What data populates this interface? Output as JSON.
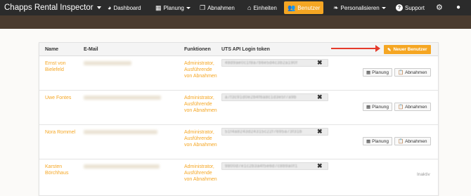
{
  "navbar": {
    "brand": "Chapps Rental Inspector",
    "items": [
      {
        "label": "Dashboard",
        "icon": "palette-icon"
      },
      {
        "label": "Planung",
        "icon": "calendar-icon"
      },
      {
        "label": "Abnahmen",
        "icon": "document-icon"
      },
      {
        "label": "Einheiten",
        "icon": "home-icon"
      },
      {
        "label": "Benutzer",
        "icon": "users-icon",
        "active": true
      },
      {
        "label": "Personalisieren",
        "icon": "leaf-icon"
      },
      {
        "label": "Support",
        "icon": "question-icon"
      }
    ]
  },
  "table": {
    "columns": [
      "Name",
      "E-Mail",
      "Funktionen",
      "UTS API Login token"
    ],
    "new_user_button": "Neuer Benutzer",
    "rows": [
      {
        "name": "Ernst von Bielefeld",
        "funktionen": "Administrator, Ausführende von Abnahmen",
        "token": "48d9ae0c1f8a7b6e5d4c3b2a190f",
        "buttons": [
          "Planung",
          "Abnahmen"
        ],
        "status": ""
      },
      {
        "name": "Uwe Fontes",
        "funktionen": "Administrator, Ausführende von Abnahmen",
        "token": "a7f3c91d0e2b4f6a8c1d3e5f7a9b",
        "buttons": [
          "Planung",
          "Abnahmen"
        ],
        "status": ""
      },
      {
        "name": "Nora Rommel",
        "funktionen": "Administrator, Ausführende von Abnahmen",
        "token": "51f4a8243d24315c22f7695a73f31b",
        "buttons": [
          "Planung",
          "Abnahmen"
        ],
        "status": ""
      },
      {
        "name": "Karsten Börchhaus",
        "funktionen": "Administrator, Ausführende von Abnahmen",
        "token": "9800d7e1c2b3a4f5e6d7c8b9a0f1",
        "buttons": [],
        "status": "Inaktiv"
      }
    ]
  },
  "colors": {
    "accent": "#f5a623",
    "navbar": "#2b2b2b",
    "band": "#4a3b2f",
    "arrow": "#e53a2a"
  }
}
